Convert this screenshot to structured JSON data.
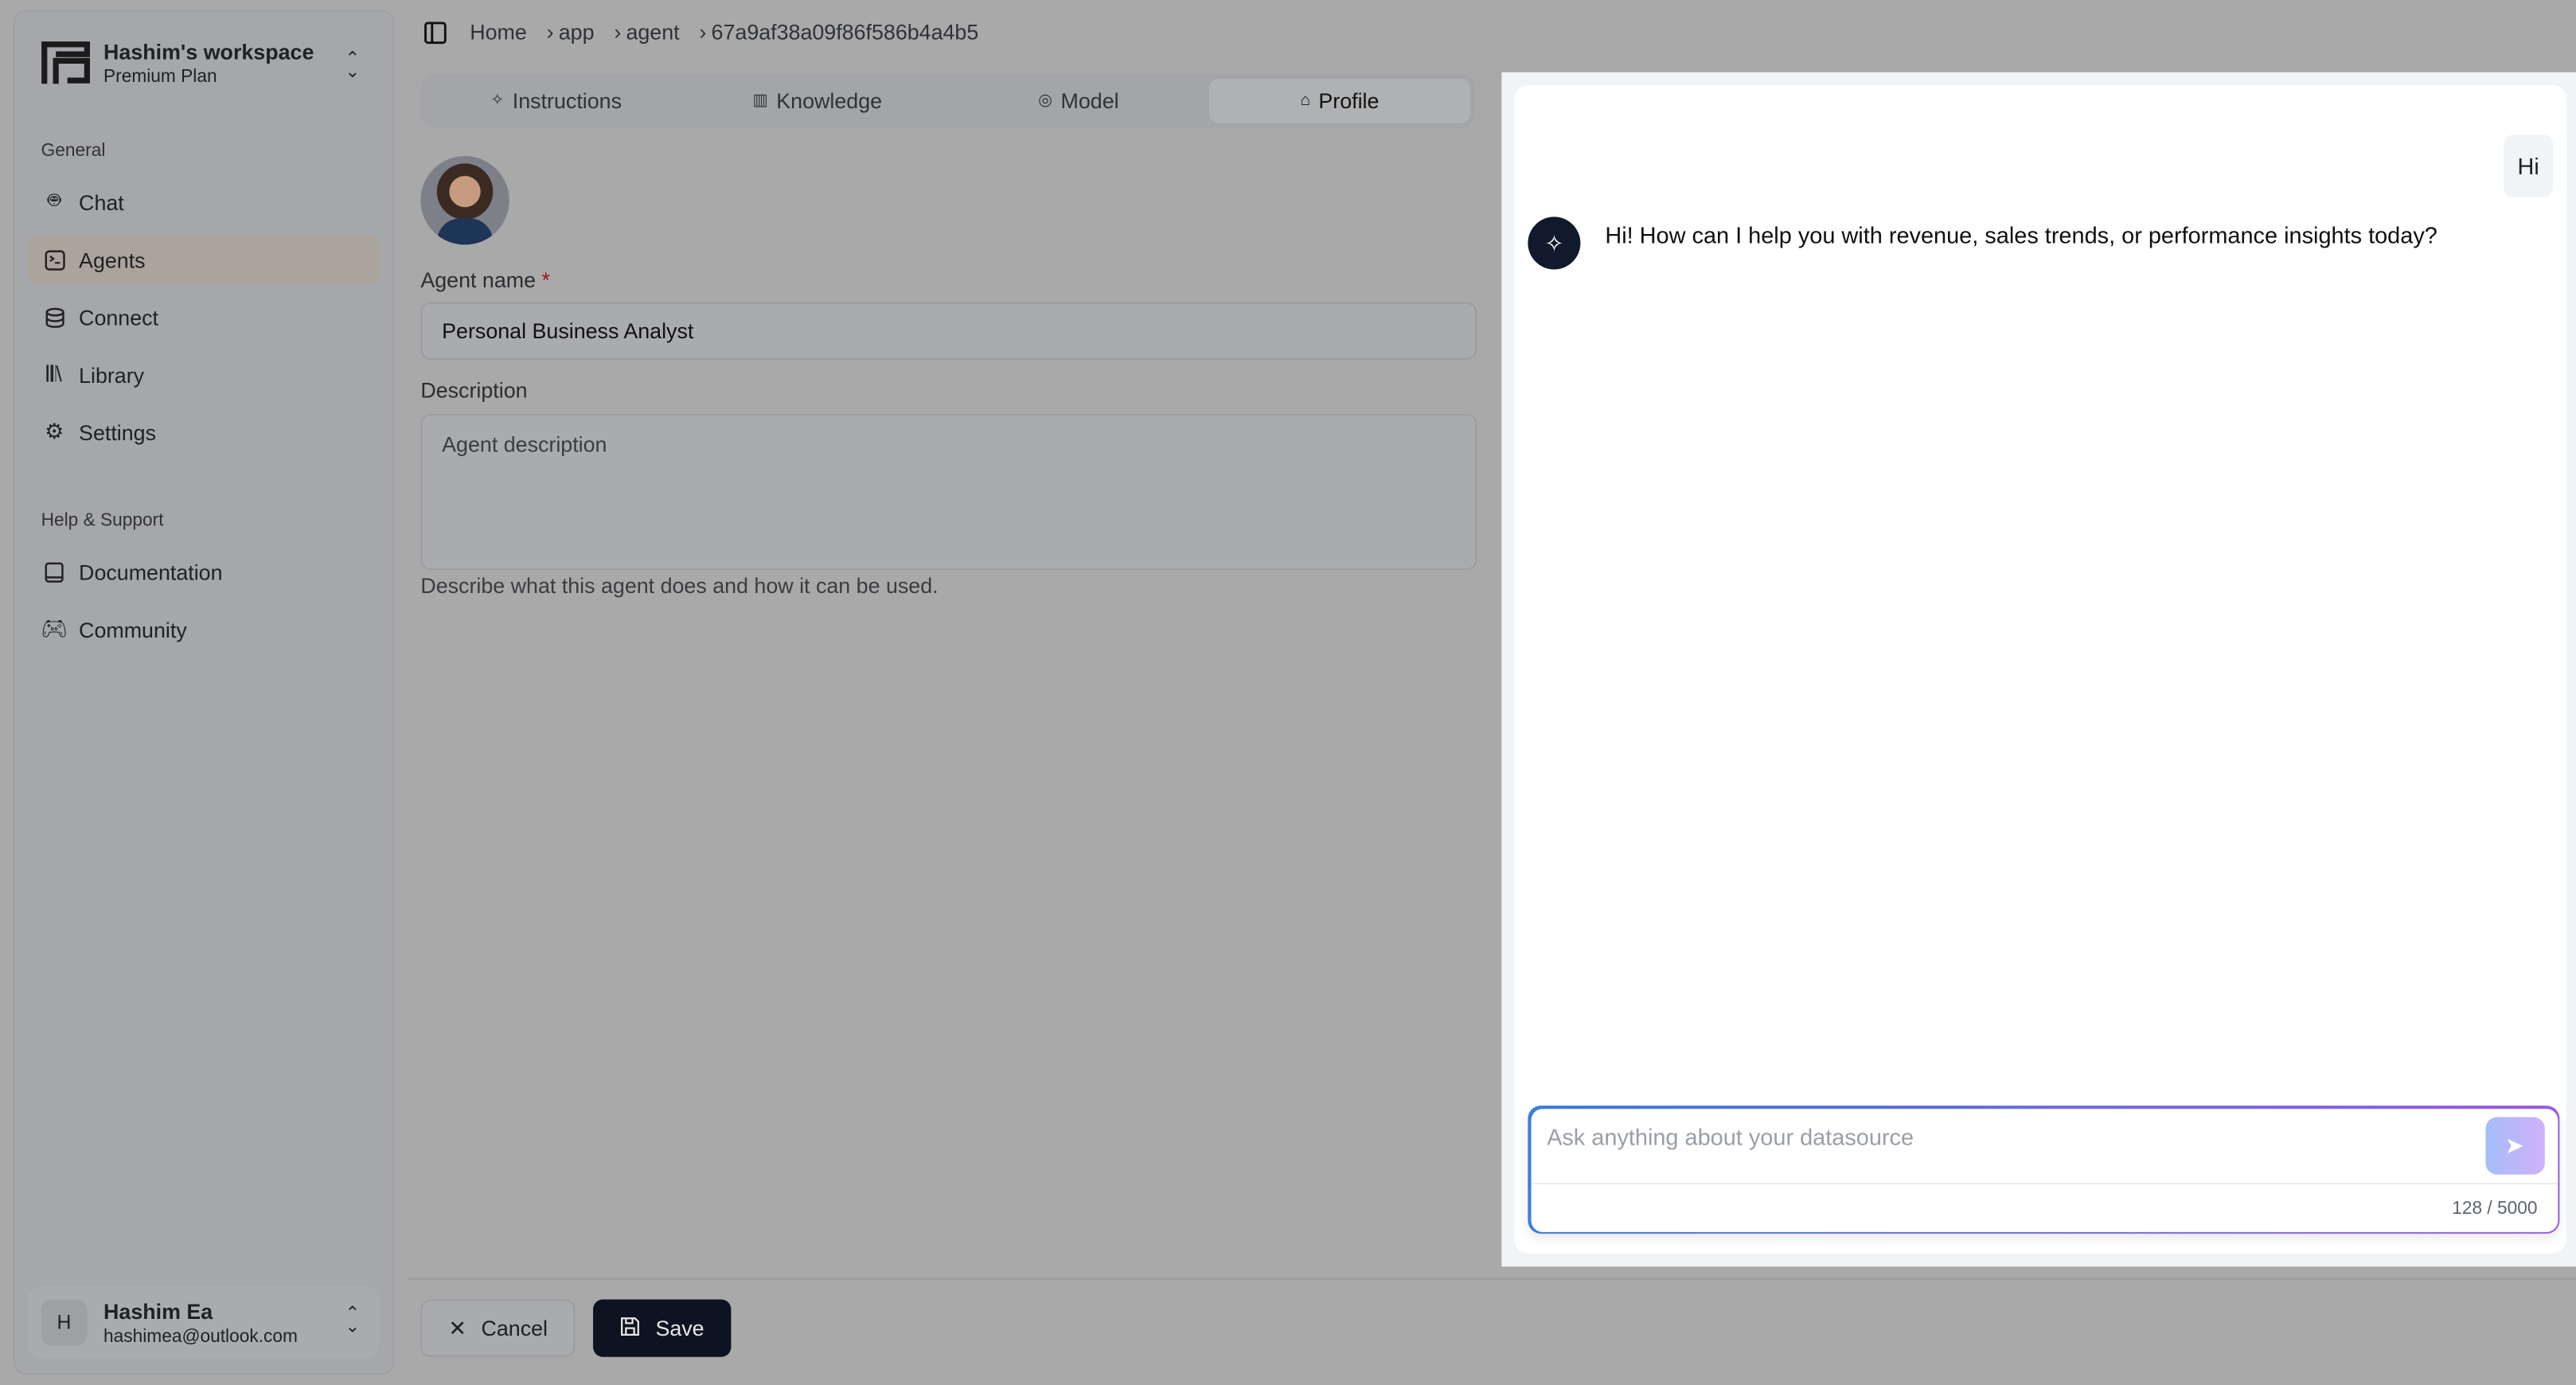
{
  "workspace": {
    "name": "Hashim's workspace",
    "plan": "Premium Plan"
  },
  "sidebar": {
    "general_label": "General",
    "items": [
      {
        "label": "Chat",
        "icon": "bot-icon"
      },
      {
        "label": "Agents",
        "icon": "terminal-square-icon",
        "active": true
      },
      {
        "label": "Connect",
        "icon": "database-icon"
      },
      {
        "label": "Library",
        "icon": "library-icon"
      },
      {
        "label": "Settings",
        "icon": "gear-icon"
      }
    ],
    "help_label": "Help & Support",
    "help_items": [
      {
        "label": "Documentation",
        "icon": "book-icon"
      },
      {
        "label": "Community",
        "icon": "gamepad-icon"
      }
    ]
  },
  "user": {
    "initial": "H",
    "name": "Hashim Ea",
    "email": "hashimea@outlook.com"
  },
  "breadcrumb": [
    "Home",
    "app",
    "agent",
    "67a9af38a09f86f586b4a4b5"
  ],
  "tabs": [
    {
      "label": "Instructions",
      "icon": "sparkles-icon"
    },
    {
      "label": "Knowledge",
      "icon": "book-open-icon"
    },
    {
      "label": "Model",
      "icon": "model-icon"
    },
    {
      "label": "Profile",
      "icon": "bot-icon",
      "active": true
    }
  ],
  "form": {
    "agent_name_label": "Agent name",
    "required_mark": "*",
    "agent_name_value": "Personal Business Analyst",
    "description_label": "Description",
    "description_placeholder": "Agent description",
    "description_hint": "Describe what this agent does and how it can be used."
  },
  "actions": {
    "cancel": "Cancel",
    "save": "Save"
  },
  "chat": {
    "messages": [
      {
        "role": "user",
        "text": "Hi"
      },
      {
        "role": "assistant",
        "text": "Hi! How can I help you with revenue, sales trends, or performance insights today?"
      }
    ],
    "input_placeholder": "Ask anything about your datasource",
    "counter": "128 / 5000"
  },
  "colors": {
    "accent_start": "#3b7be0",
    "accent_end": "#9b5de5",
    "save_button": "#0d1320"
  }
}
